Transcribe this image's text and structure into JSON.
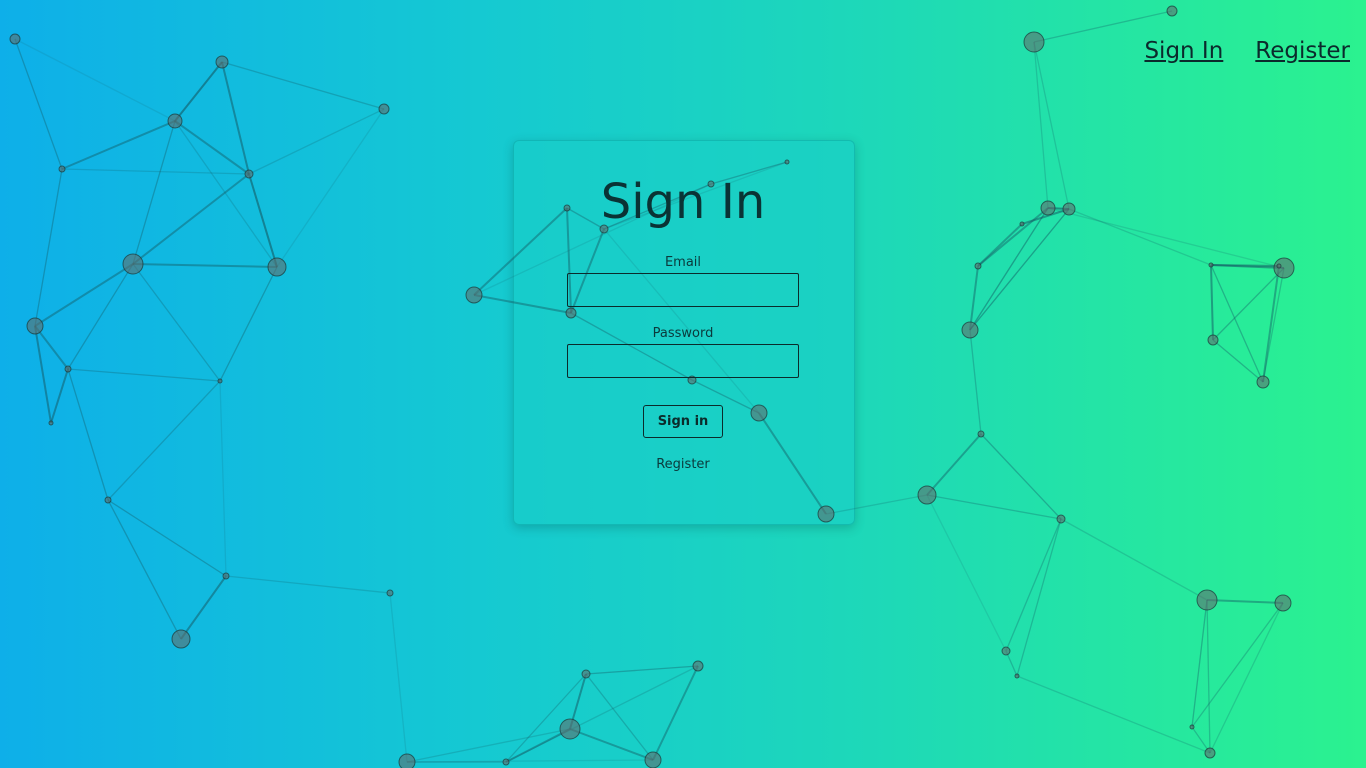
{
  "nav": {
    "sign_in": "Sign In",
    "register": "Register"
  },
  "card": {
    "title": "Sign In",
    "email_label": "Email",
    "email_value": "",
    "password_label": "Password",
    "password_value": "",
    "submit_label": "Sign in",
    "register_link": "Register"
  },
  "colors": {
    "gradient_start": "#0eafe9",
    "gradient_end": "#2bf28f",
    "text_dark": "#0a3335",
    "node_fill": "#6b7a7a"
  }
}
